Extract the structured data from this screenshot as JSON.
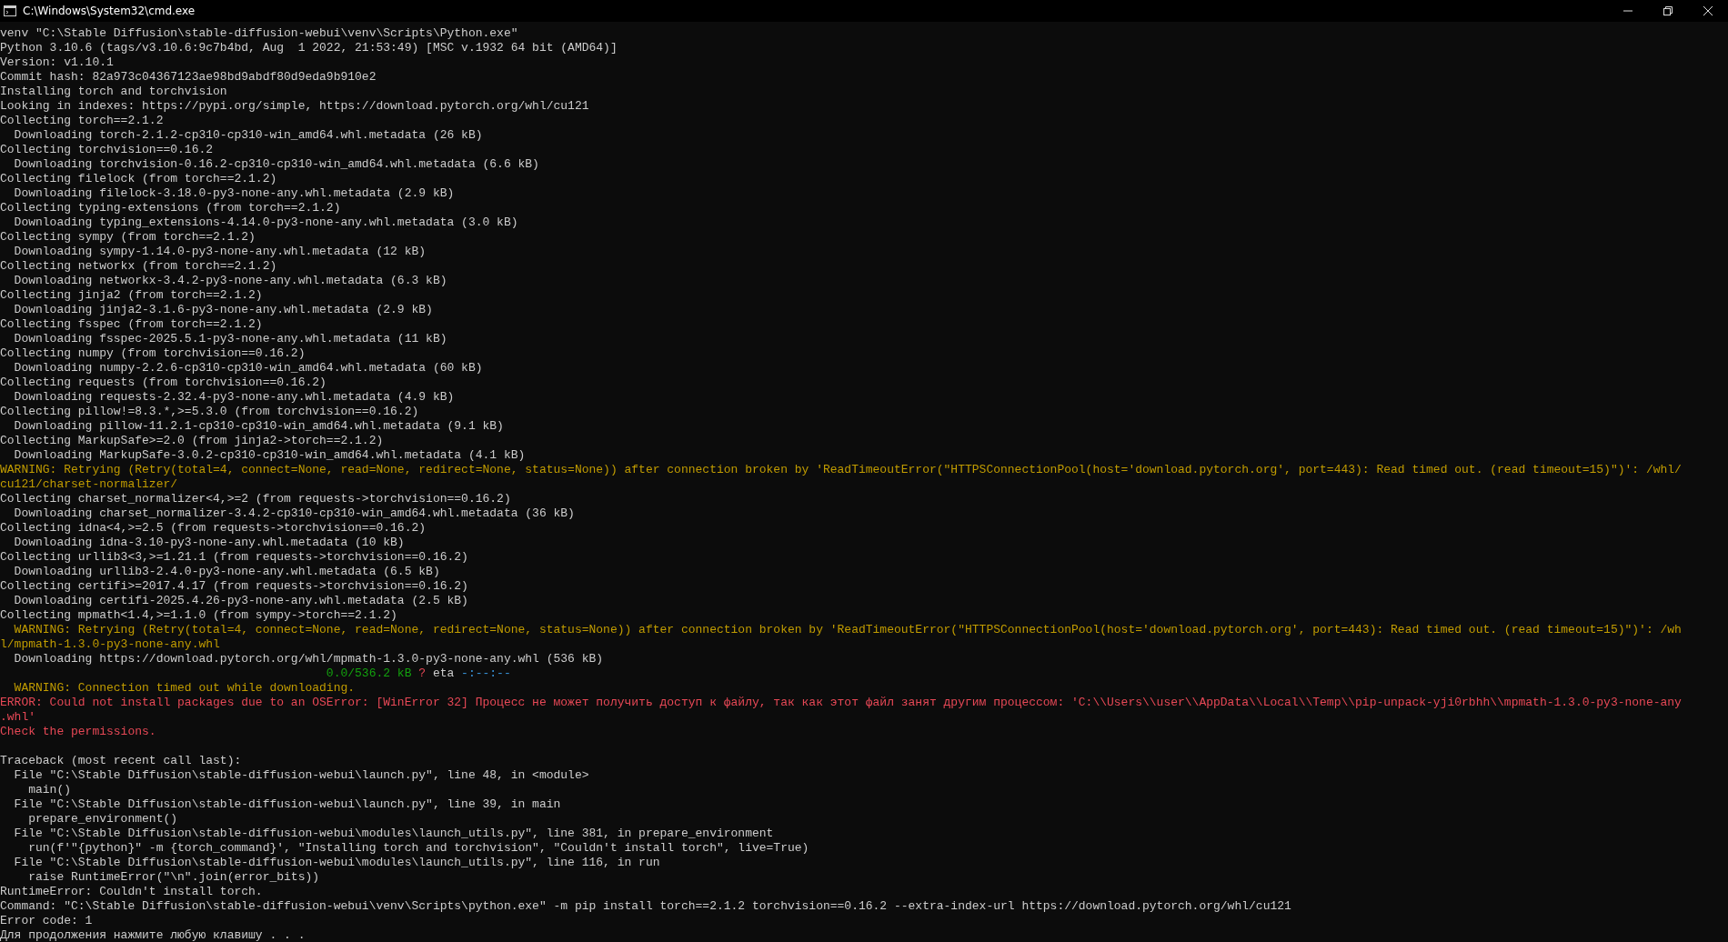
{
  "window": {
    "title": "C:\\Windows\\System32\\cmd.exe"
  },
  "lines": [
    {
      "kind": "normal",
      "text": "venv \"C:\\Stable Diffusion\\stable-diffusion-webui\\venv\\Scripts\\Python.exe\""
    },
    {
      "kind": "normal",
      "text": "Python 3.10.6 (tags/v3.10.6:9c7b4bd, Aug  1 2022, 21:53:49) [MSC v.1932 64 bit (AMD64)]"
    },
    {
      "kind": "normal",
      "text": "Version: v1.10.1"
    },
    {
      "kind": "normal",
      "text": "Commit hash: 82a973c04367123ae98bd9abdf80d9eda9b910e2"
    },
    {
      "kind": "normal",
      "text": "Installing torch and torchvision"
    },
    {
      "kind": "normal",
      "text": "Looking in indexes: https://pypi.org/simple, https://download.pytorch.org/whl/cu121"
    },
    {
      "kind": "normal",
      "text": "Collecting torch==2.1.2"
    },
    {
      "kind": "normal",
      "text": "  Downloading torch-2.1.2-cp310-cp310-win_amd64.whl.metadata (26 kB)"
    },
    {
      "kind": "normal",
      "text": "Collecting torchvision==0.16.2"
    },
    {
      "kind": "normal",
      "text": "  Downloading torchvision-0.16.2-cp310-cp310-win_amd64.whl.metadata (6.6 kB)"
    },
    {
      "kind": "normal",
      "text": "Collecting filelock (from torch==2.1.2)"
    },
    {
      "kind": "normal",
      "text": "  Downloading filelock-3.18.0-py3-none-any.whl.metadata (2.9 kB)"
    },
    {
      "kind": "normal",
      "text": "Collecting typing-extensions (from torch==2.1.2)"
    },
    {
      "kind": "normal",
      "text": "  Downloading typing_extensions-4.14.0-py3-none-any.whl.metadata (3.0 kB)"
    },
    {
      "kind": "normal",
      "text": "Collecting sympy (from torch==2.1.2)"
    },
    {
      "kind": "normal",
      "text": "  Downloading sympy-1.14.0-py3-none-any.whl.metadata (12 kB)"
    },
    {
      "kind": "normal",
      "text": "Collecting networkx (from torch==2.1.2)"
    },
    {
      "kind": "normal",
      "text": "  Downloading networkx-3.4.2-py3-none-any.whl.metadata (6.3 kB)"
    },
    {
      "kind": "normal",
      "text": "Collecting jinja2 (from torch==2.1.2)"
    },
    {
      "kind": "normal",
      "text": "  Downloading jinja2-3.1.6-py3-none-any.whl.metadata (2.9 kB)"
    },
    {
      "kind": "normal",
      "text": "Collecting fsspec (from torch==2.1.2)"
    },
    {
      "kind": "normal",
      "text": "  Downloading fsspec-2025.5.1-py3-none-any.whl.metadata (11 kB)"
    },
    {
      "kind": "normal",
      "text": "Collecting numpy (from torchvision==0.16.2)"
    },
    {
      "kind": "normal",
      "text": "  Downloading numpy-2.2.6-cp310-cp310-win_amd64.whl.metadata (60 kB)"
    },
    {
      "kind": "normal",
      "text": "Collecting requests (from torchvision==0.16.2)"
    },
    {
      "kind": "normal",
      "text": "  Downloading requests-2.32.4-py3-none-any.whl.metadata (4.9 kB)"
    },
    {
      "kind": "normal",
      "text": "Collecting pillow!=8.3.*,>=5.3.0 (from torchvision==0.16.2)"
    },
    {
      "kind": "normal",
      "text": "  Downloading pillow-11.2.1-cp310-cp310-win_amd64.whl.metadata (9.1 kB)"
    },
    {
      "kind": "normal",
      "text": "Collecting MarkupSafe>=2.0 (from jinja2->torch==2.1.2)"
    },
    {
      "kind": "normal",
      "text": "  Downloading MarkupSafe-3.0.2-cp310-cp310-win_amd64.whl.metadata (4.1 kB)"
    },
    {
      "kind": "warning",
      "text": "WARNING: Retrying (Retry(total=4, connect=None, read=None, redirect=None, status=None)) after connection broken by 'ReadTimeoutError(\"HTTPSConnectionPool(host='download.pytorch.org', port=443): Read timed out. (read timeout=15)\")': /whl/"
    },
    {
      "kind": "warning",
      "text": "cu121/charset-normalizer/"
    },
    {
      "kind": "normal",
      "text": "Collecting charset_normalizer<4,>=2 (from requests->torchvision==0.16.2)"
    },
    {
      "kind": "normal",
      "text": "  Downloading charset_normalizer-3.4.2-cp310-cp310-win_amd64.whl.metadata (36 kB)"
    },
    {
      "kind": "normal",
      "text": "Collecting idna<4,>=2.5 (from requests->torchvision==0.16.2)"
    },
    {
      "kind": "normal",
      "text": "  Downloading idna-3.10-py3-none-any.whl.metadata (10 kB)"
    },
    {
      "kind": "normal",
      "text": "Collecting urllib3<3,>=1.21.1 (from requests->torchvision==0.16.2)"
    },
    {
      "kind": "normal",
      "text": "  Downloading urllib3-2.4.0-py3-none-any.whl.metadata (6.5 kB)"
    },
    {
      "kind": "normal",
      "text": "Collecting certifi>=2017.4.17 (from requests->torchvision==0.16.2)"
    },
    {
      "kind": "normal",
      "text": "  Downloading certifi-2025.4.26-py3-none-any.whl.metadata (2.5 kB)"
    },
    {
      "kind": "normal",
      "text": "Collecting mpmath<1.4,>=1.1.0 (from sympy->torch==2.1.2)"
    },
    {
      "kind": "warning",
      "text": "  WARNING: Retrying (Retry(total=4, connect=None, read=None, redirect=None, status=None)) after connection broken by 'ReadTimeoutError(\"HTTPSConnectionPool(host='download.pytorch.org', port=443): Read timed out. (read timeout=15)\")': /wh"
    },
    {
      "kind": "warning",
      "text": "l/mpmath-1.3.0-py3-none-any.whl"
    },
    {
      "kind": "normal",
      "text": "  Downloading https://download.pytorch.org/whl/mpmath-1.3.0-py3-none-any.whl (536 kB)"
    },
    {
      "kind": "progress",
      "parts": [
        {
          "kind": "done",
          "text": "0.0/536.2 kB"
        },
        {
          "kind": "unknown",
          "text": "?"
        },
        {
          "kind": "label",
          "text": "eta"
        },
        {
          "kind": "eta",
          "text": "-:--:--"
        }
      ]
    },
    {
      "kind": "warning",
      "text": "  WARNING: Connection timed out while downloading."
    },
    {
      "kind": "error",
      "text": "ERROR: Could not install packages due to an OSError: [WinError 32] Процесс не может получить доступ к файлу, так как этот файл занят другим процессом: 'C:\\\\Users\\\\user\\\\AppData\\\\Local\\\\Temp\\\\pip-unpack-yji0rbhh\\\\mpmath-1.3.0-py3-none-any"
    },
    {
      "kind": "error",
      "text": ".whl'"
    },
    {
      "kind": "error",
      "text": "Check the permissions."
    },
    {
      "kind": "blank"
    },
    {
      "kind": "normal",
      "text": "Traceback (most recent call last):"
    },
    {
      "kind": "normal",
      "text": "  File \"C:\\Stable Diffusion\\stable-diffusion-webui\\launch.py\", line 48, in <module>"
    },
    {
      "kind": "normal",
      "text": "    main()"
    },
    {
      "kind": "normal",
      "text": "  File \"C:\\Stable Diffusion\\stable-diffusion-webui\\launch.py\", line 39, in main"
    },
    {
      "kind": "normal",
      "text": "    prepare_environment()"
    },
    {
      "kind": "normal",
      "text": "  File \"C:\\Stable Diffusion\\stable-diffusion-webui\\modules\\launch_utils.py\", line 381, in prepare_environment"
    },
    {
      "kind": "normal",
      "text": "    run(f'\"{python}\" -m {torch_command}', \"Installing torch and torchvision\", \"Couldn't install torch\", live=True)"
    },
    {
      "kind": "normal",
      "text": "  File \"C:\\Stable Diffusion\\stable-diffusion-webui\\modules\\launch_utils.py\", line 116, in run"
    },
    {
      "kind": "normal",
      "text": "    raise RuntimeError(\"\\n\".join(error_bits))"
    },
    {
      "kind": "normal",
      "text": "RuntimeError: Couldn't install torch."
    },
    {
      "kind": "normal",
      "text": "Command: \"C:\\Stable Diffusion\\stable-diffusion-webui\\venv\\Scripts\\python.exe\" -m pip install torch==2.1.2 torchvision==0.16.2 --extra-index-url https://download.pytorch.org/whl/cu121"
    },
    {
      "kind": "normal",
      "text": "Error code: 1"
    },
    {
      "kind": "normal",
      "text": "Для продолжения нажмите любую клавишу . . ."
    }
  ]
}
